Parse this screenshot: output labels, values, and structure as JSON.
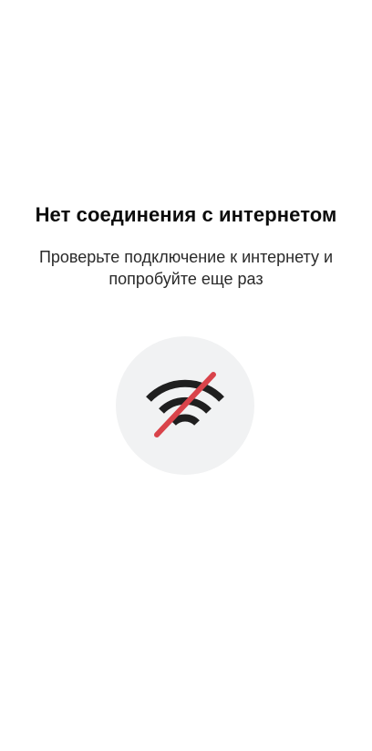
{
  "message": {
    "title": "Нет соединения с интернетом",
    "subtitle": "Проверьте подключение к интернету и попробуйте еще раз"
  },
  "icon": {
    "name": "wifi-off-icon",
    "circle_color": "#f1f2f3",
    "wave_color": "#1f1f1f",
    "slash_color": "#d9434a"
  }
}
